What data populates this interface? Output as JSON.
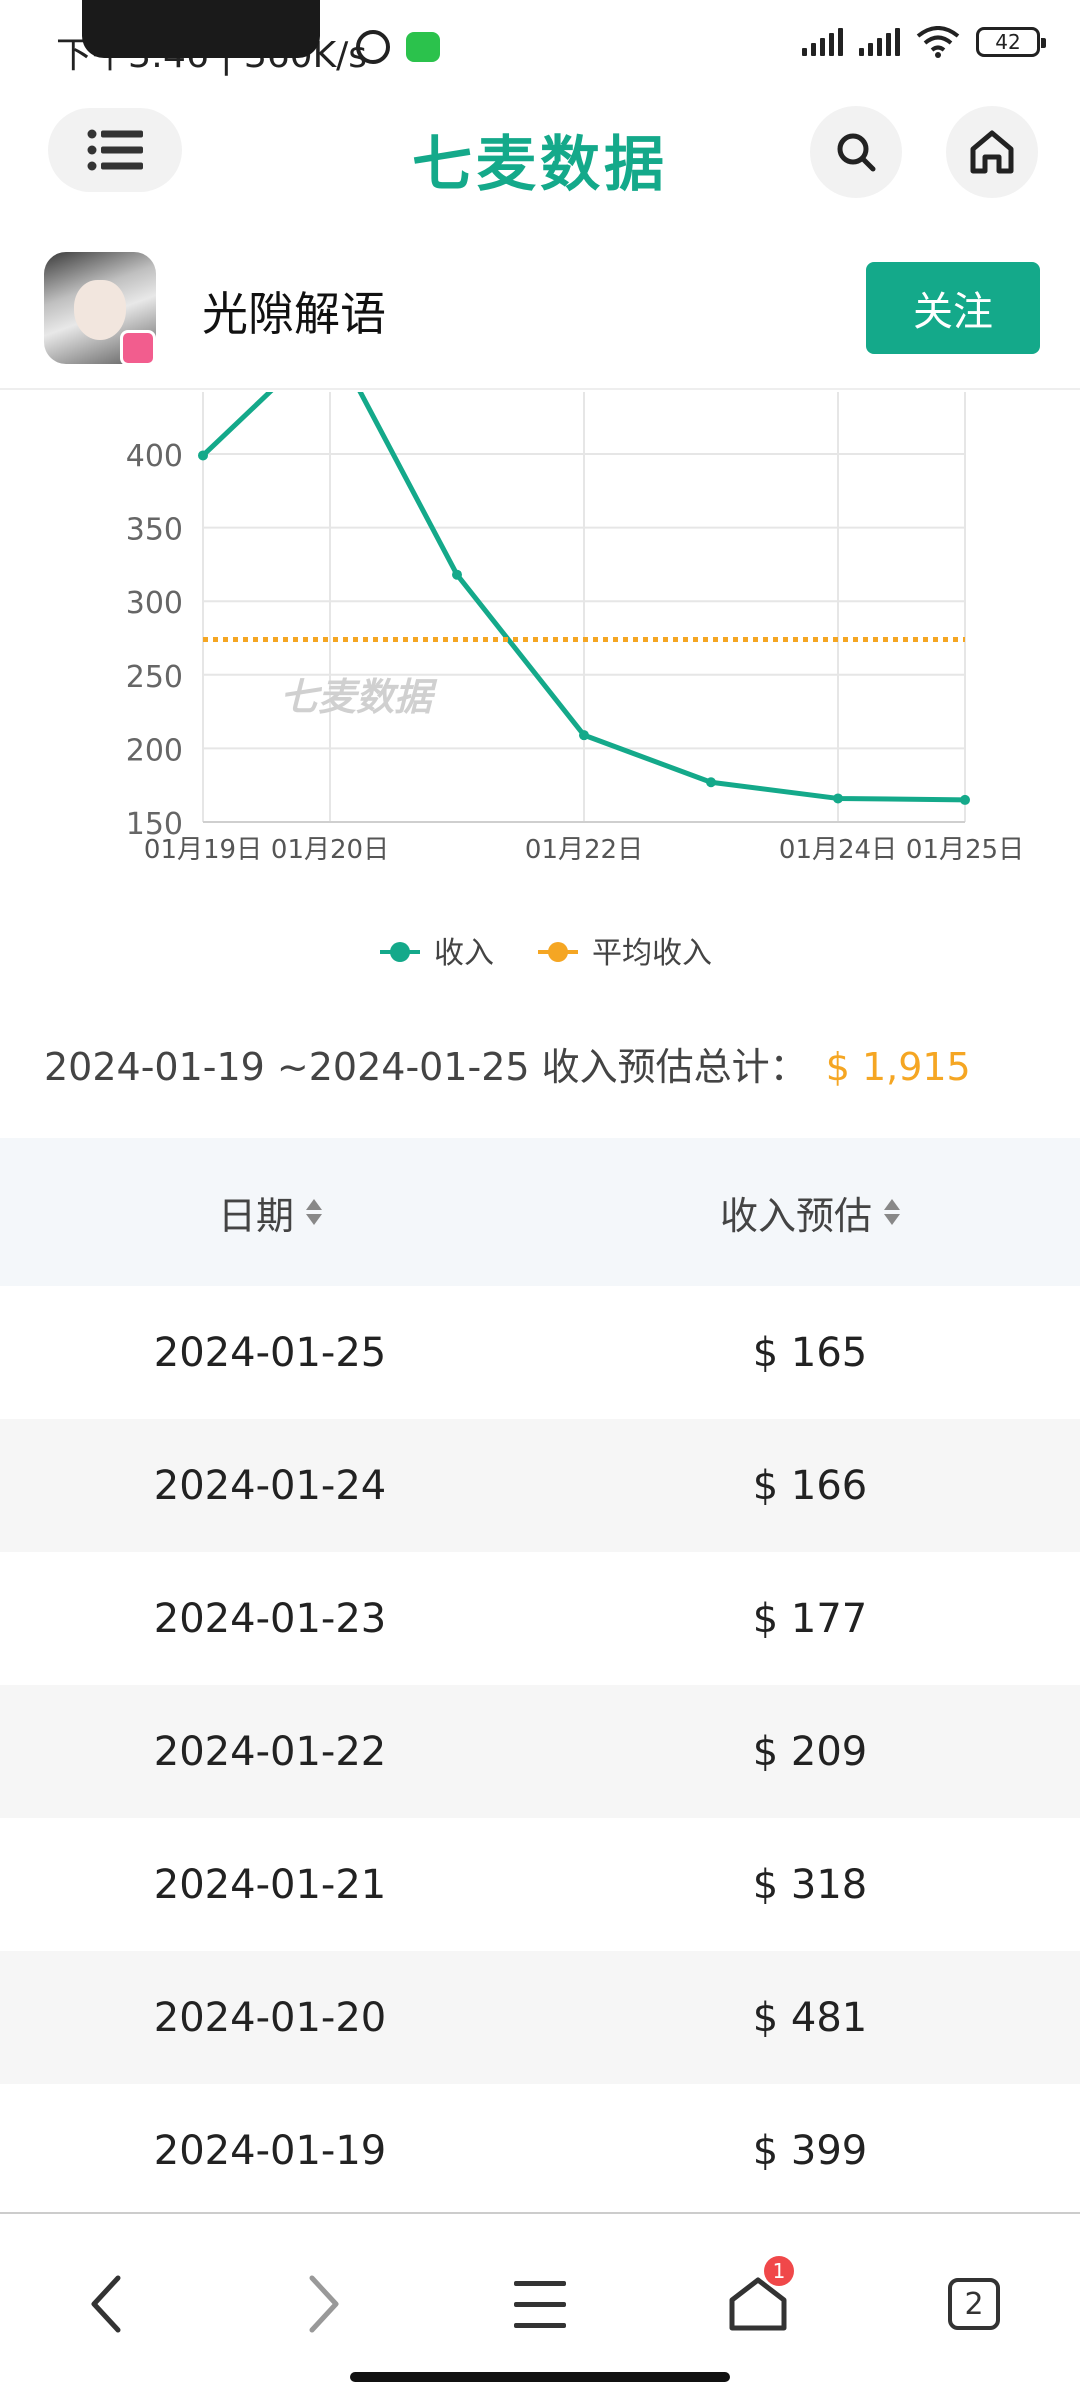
{
  "status_bar": {
    "time": "下午3:46 | 360K/s",
    "battery": "42"
  },
  "nav": {
    "logo": "七麦数据"
  },
  "app": {
    "name": "光隙解语",
    "follow_label": "关注"
  },
  "colors": {
    "brand": "#14a98a",
    "accent_orange": "#f5a623"
  },
  "chart_data": {
    "type": "line",
    "x": [
      "01月19日",
      "01月20日",
      "01月21日",
      "01月22日",
      "01月23日",
      "01月24日",
      "01月25日"
    ],
    "x_tick_labels": [
      "01月19日",
      "01月20日",
      "01月22日",
      "01月24日",
      "01月25日"
    ],
    "y_ticks": [
      "150",
      "200",
      "250",
      "300",
      "350",
      "400"
    ],
    "ylim": [
      150,
      400
    ],
    "series": [
      {
        "name": "收入",
        "values": [
          399,
          481,
          318,
          209,
          177,
          166,
          165
        ],
        "color": "#14a98a"
      },
      {
        "name": "平均收入",
        "values": [
          274,
          274,
          274,
          274,
          274,
          274,
          274
        ],
        "color": "#f5a623",
        "style": "dotted"
      }
    ],
    "watermark": "七麦数据",
    "legend_position": "bottom",
    "grid": true
  },
  "summary": {
    "range": "2024-01-19 ~2024-01-25 收入预估总计：",
    "total": "$ 1,915"
  },
  "table": {
    "headers": [
      "日期",
      "收入预估"
    ],
    "rows": [
      [
        "2024-01-25",
        "$ 165"
      ],
      [
        "2024-01-24",
        "$ 166"
      ],
      [
        "2024-01-23",
        "$ 177"
      ],
      [
        "2024-01-22",
        "$ 209"
      ],
      [
        "2024-01-21",
        "$ 318"
      ],
      [
        "2024-01-20",
        "$ 481"
      ],
      [
        "2024-01-19",
        "$ 399"
      ]
    ]
  },
  "bottom_nav": {
    "home_badge": "1",
    "tab_count": "2"
  }
}
